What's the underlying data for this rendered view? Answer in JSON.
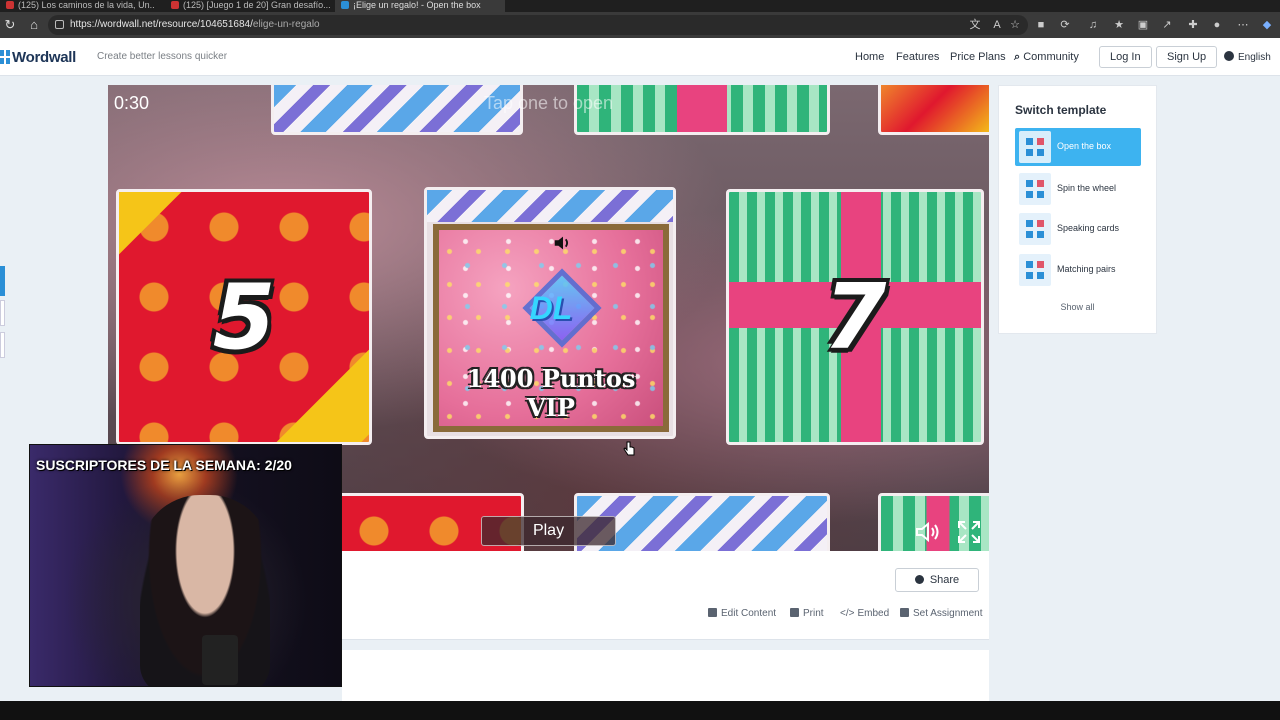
{
  "browser": {
    "tabs": [
      {
        "label": "(125) Los caminos de la vida, Un..."
      },
      {
        "label": "(125) [Juego 1 de 20] Gran desafío..."
      },
      {
        "label": "¡Elige un regalo! - Open the box"
      }
    ],
    "url_host": "https://wordwall.net/resource/104651684/",
    "url_path": "elige-un-regalo"
  },
  "header": {
    "logo": "Wordwall",
    "tagline": "Create better lessons quicker",
    "nav": [
      "Home",
      "Features",
      "Price Plans",
      "Community"
    ],
    "login": "Log In",
    "signup": "Sign Up",
    "language": "English"
  },
  "game": {
    "timer": "0:30",
    "instruction": "Tap one to open",
    "box_left_number": "5",
    "box_right_number": "7",
    "prize_logo": "DL",
    "prize_text": "1400 Puntos VIP",
    "play_label": "Play"
  },
  "actions": {
    "share": "Share",
    "edit": "Edit Content",
    "print": "Print",
    "embed": "Embed",
    "assignment": "Set Assignment"
  },
  "sidebar": {
    "title": "Switch template",
    "templates": [
      {
        "label": "Open the box"
      },
      {
        "label": "Spin the wheel"
      },
      {
        "label": "Speaking cards"
      },
      {
        "label": "Matching pairs"
      }
    ],
    "show_all": "Show all"
  },
  "webcam": {
    "overlay": "SUSCRIPTORES DE LA SEMANA: 2/20"
  }
}
